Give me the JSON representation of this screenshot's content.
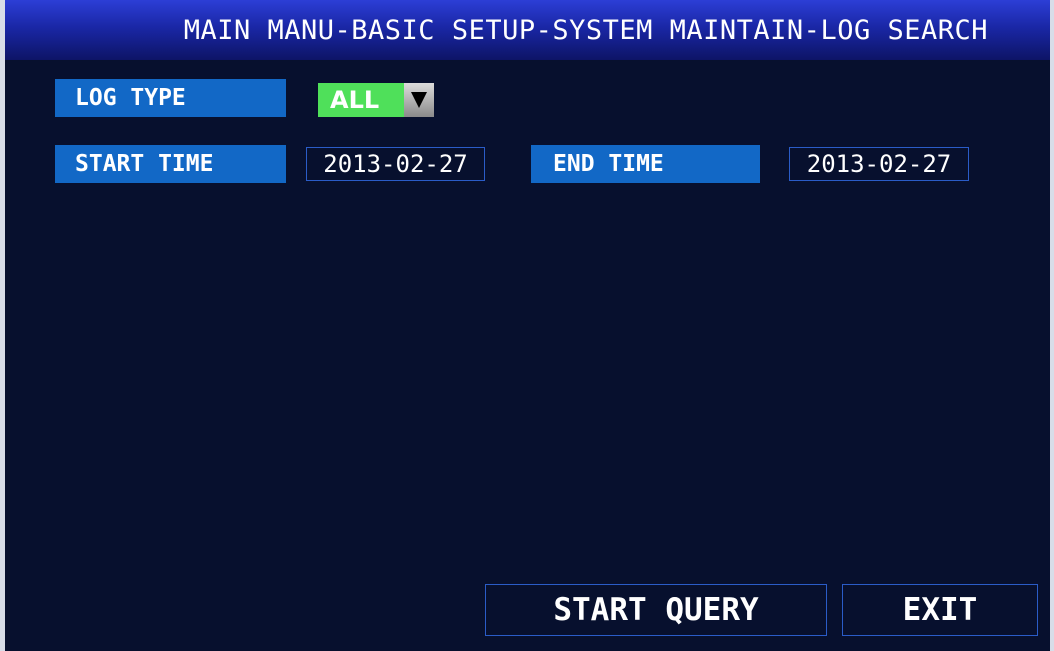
{
  "title": "MAIN MANU-BASIC SETUP-SYSTEM MAINTAIN-LOG SEARCH",
  "log_type": {
    "label": "LOG TYPE",
    "value": "ALL",
    "arrow_icon": "triangle-down-icon"
  },
  "start_time": {
    "label": "START TIME",
    "value": "2013-02-27"
  },
  "end_time": {
    "label": "END TIME",
    "value": "2013-02-27"
  },
  "buttons": {
    "start_query": "START QUERY",
    "exit": "EXIT"
  },
  "colors": {
    "background": "#07102e",
    "title_bar": "#1a27a6",
    "label_bg": "#1268c6",
    "selected": "#4fe05a",
    "border": "#2a5cc8"
  }
}
